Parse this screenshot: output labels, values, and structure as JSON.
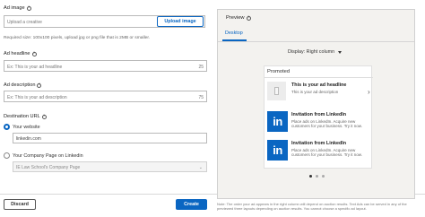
{
  "form": {
    "ad_image": {
      "label": "Ad image",
      "placeholder": "Upload a creative",
      "upload_label": "Upload image",
      "hint": "Required size: 100x100 pixels, upload jpg or png file that is 2MB or smaller."
    },
    "ad_headline": {
      "label": "Ad headline",
      "placeholder": "Ex: This is your ad headline",
      "count": "25"
    },
    "ad_description": {
      "label": "Ad description",
      "placeholder": "Ex: This is your ad description",
      "count": "75"
    },
    "destination": {
      "label": "Destination URL",
      "website_label": "Your website",
      "website_value": "linkedin.com",
      "company_label": "Your Company Page on Linkedin",
      "company_value": "IE Law School's Company Page"
    }
  },
  "actions": {
    "discard_label": "Discard",
    "create_label": "Create"
  },
  "preview": {
    "title": "Preview",
    "tab_desktop": "Desktop",
    "display_label": "Display: Right column",
    "promoted_label": "Promoted",
    "ads": [
      {
        "headline": "This is your ad headline",
        "description": "This is your ad description"
      },
      {
        "headline": "Invitation from LinkedIn",
        "description": "Place ads on LinkedIn. Acquire new customers for your business. Try it now."
      },
      {
        "headline": "Invitation from LinkedIn",
        "description": "Place ads on LinkedIn. Acquire new customers for your business. Try it now."
      }
    ],
    "logo_text": "in",
    "carousel": {
      "dots": 3,
      "active_index": 0
    },
    "note": "Note: The order your ad appears in the right column will depend on auction results. Text Ads can be served in any of the previewed three layouts depending on auction results. You cannot choose a specific ad layout."
  },
  "colors": {
    "accent": "#0a66c2",
    "preview_bg": "#f3f2ef"
  },
  "icons": {
    "help": "help-circle-icon",
    "next": "chevron-right-icon",
    "select": "chevron-down-icon",
    "image": "image-placeholder-icon"
  }
}
